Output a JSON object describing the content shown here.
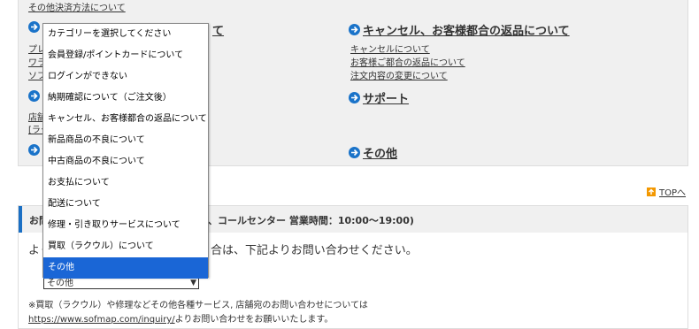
{
  "top_link": "その他決済方法について",
  "sections": {
    "left_title_fragment": "て",
    "cancel": {
      "title": "キャンセル、お客様都合の返品について",
      "links": [
        "キャンセルについて",
        "お客様ご都合の返品について",
        "注文内容の変更について"
      ]
    },
    "support": {
      "title": "サポート"
    },
    "other": {
      "title": "その他"
    },
    "left_fragments": [
      "プレ",
      "ワラ",
      "ソフ",
      "店舗",
      "[ラク"
    ]
  },
  "top_nav": {
    "label": "TOPへ"
  },
  "call": {
    "head_left": "お問",
    "head_text": "、コールセンター 営業時間：10:00～19:00)",
    "body_left": "よく",
    "body_text": "合は、下記よりお問い合わせください。",
    "note": "※買取（ラクウル）や修理などその他各種サービス, 店舗宛のお問い合わせについては",
    "note_url": "https://www.sofmap.com/inquiry/",
    "note_tail": "よりお問い合わせをお願いいたします。"
  },
  "select": {
    "value": "その他",
    "options": [
      "カテゴリーを選択してください",
      "会員登録/ポイントカードについて",
      "ログインができない",
      "納期確認について（ご注文後）",
      "キャンセル、お客様都合の返品について",
      "新品商品の不良について",
      "中古商品の不良について",
      "お支払について",
      "配送について",
      "修理・引き取りサービスについて",
      "買取（ラクウル）について",
      "その他"
    ],
    "selected_index": 11
  },
  "colors": {
    "accent": "#1a73c9",
    "selected": "#1a66d6",
    "top_icon": "#f39800"
  }
}
